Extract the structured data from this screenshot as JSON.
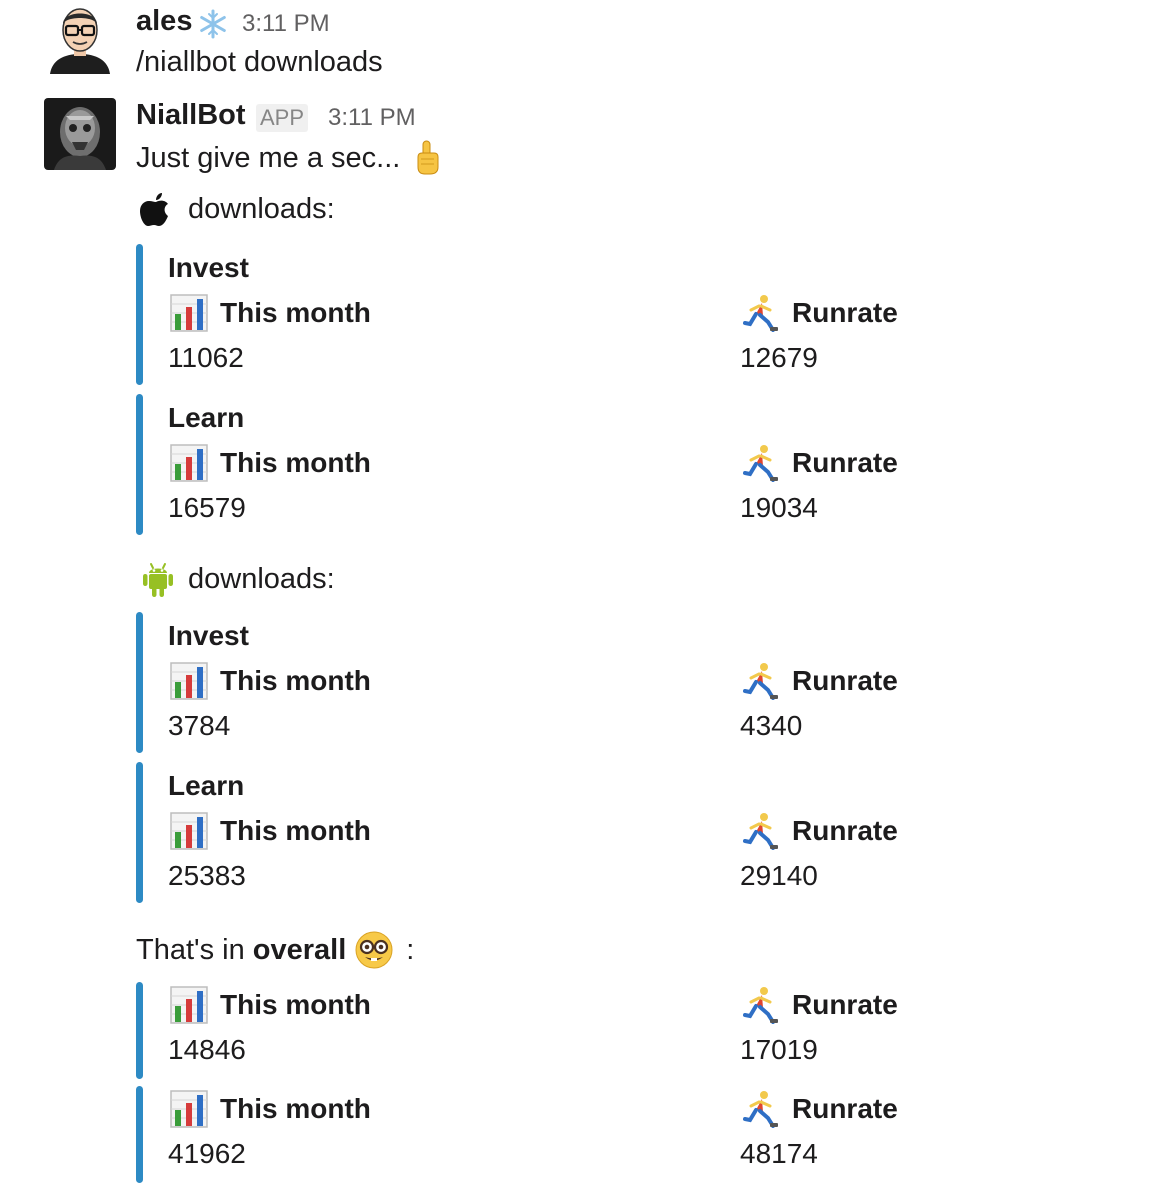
{
  "messages": [
    {
      "sender": "ales",
      "status_icon": "snowflake-icon",
      "time": "3:11 PM",
      "text": "/niallbot downloads"
    },
    {
      "sender": "NiallBot",
      "badge": "APP",
      "time": "3:11 PM",
      "text": "Just give me a sec...",
      "emoji": "pointing-up-icon"
    }
  ],
  "ios": {
    "icon": "apple-icon",
    "heading": "downloads:",
    "attachments": [
      {
        "title": "Invest",
        "month_label": "This month",
        "month_value": "11062",
        "runrate_label": "Runrate",
        "runrate_value": "12679"
      },
      {
        "title": "Learn",
        "month_label": "This month",
        "month_value": "16579",
        "runrate_label": "Runrate",
        "runrate_value": "19034"
      }
    ]
  },
  "android": {
    "icon": "android-icon",
    "heading": "downloads:",
    "attachments": [
      {
        "title": "Invest",
        "month_label": "This month",
        "month_value": "3784",
        "runrate_label": "Runrate",
        "runrate_value": "4340"
      },
      {
        "title": "Learn",
        "month_label": "This month",
        "month_value": "25383",
        "runrate_label": "Runrate",
        "runrate_value": "29140"
      }
    ]
  },
  "overall": {
    "prefix": "That's in ",
    "bold": "overall",
    "emoji": "nerd-face-icon",
    "suffix": ":",
    "attachments": [
      {
        "month_label": "This month",
        "month_value": "14846",
        "runrate_label": "Runrate",
        "runrate_value": "17019"
      },
      {
        "month_label": "This month",
        "month_value": "41962",
        "runrate_label": "Runrate",
        "runrate_value": "48174"
      }
    ]
  },
  "colors": {
    "attachment_bar": "#2d8ac4",
    "timestamp": "#616061",
    "text": "#1d1c1d"
  }
}
